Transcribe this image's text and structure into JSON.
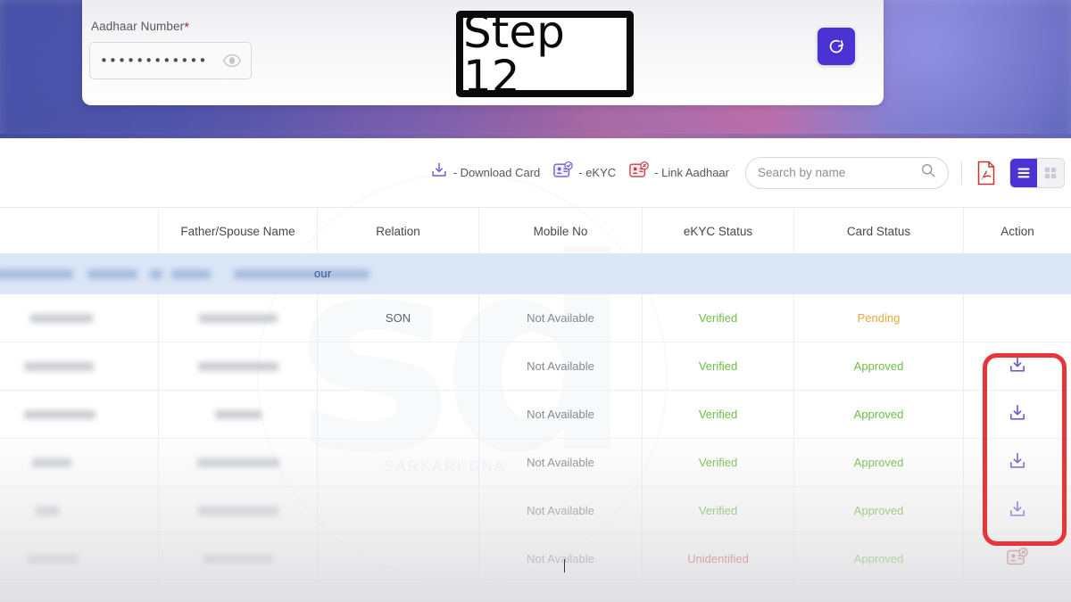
{
  "banner": {
    "form": {
      "label": "Aadhaar Number",
      "required_mark": "*",
      "masked_value": "••••••••••••",
      "eye_icon": "eye-icon",
      "refresh_icon": "refresh-icon"
    }
  },
  "step_badge": {
    "text": "Step 12"
  },
  "toolbar": {
    "legend": [
      {
        "icon": "download-icon",
        "label": "- Download Card",
        "color": "#6b5fd0"
      },
      {
        "icon": "ekyc-card-icon",
        "label": "- eKYC",
        "color": "#6b5fd0"
      },
      {
        "icon": "link-aadhaar-card-icon",
        "label": "- Link Aadhaar",
        "color": "#cf3a45"
      }
    ],
    "search": {
      "placeholder": "Search by name",
      "value": "",
      "icon": "search-icon"
    },
    "pdf_icon": "pdf-export-icon",
    "view_toggle": {
      "list_icon": "list-view-icon",
      "grid_icon": "grid-view-icon",
      "active": "list",
      "active_color": "#4b32d2"
    }
  },
  "table": {
    "columns": [
      {
        "key": "name",
        "label": ""
      },
      {
        "key": "father_spouse",
        "label": "Father/Spouse Name"
      },
      {
        "key": "relation",
        "label": "Relation"
      },
      {
        "key": "mobile",
        "label": "Mobile No"
      },
      {
        "key": "ekyc_status",
        "label": "eKYC Status"
      },
      {
        "key": "card_status",
        "label": "Card Status"
      },
      {
        "key": "action",
        "label": "Action"
      }
    ],
    "highlight_row": {
      "redacted": true,
      "visible_tail": "our"
    },
    "rows": [
      {
        "name": "",
        "father_spouse": "",
        "relation": "SON",
        "mobile": "Not Available",
        "ekyc_status": "Verified",
        "card_status": "Pending",
        "action_icon": ""
      },
      {
        "name": "",
        "father_spouse": "",
        "relation": "",
        "mobile": "Not Available",
        "ekyc_status": "Verified",
        "card_status": "Approved",
        "action_icon": "download-icon"
      },
      {
        "name": "",
        "father_spouse": "",
        "relation": "",
        "mobile": "Not Available",
        "ekyc_status": "Verified",
        "card_status": "Approved",
        "action_icon": "download-icon"
      },
      {
        "name": "",
        "father_spouse": "",
        "relation": "",
        "mobile": "Not Available",
        "ekyc_status": "Verified",
        "card_status": "Approved",
        "action_icon": "download-icon"
      },
      {
        "name": "",
        "father_spouse": "",
        "relation": "",
        "mobile": "Not Available",
        "ekyc_status": "Verified",
        "card_status": "Approved",
        "action_icon": "download-icon"
      },
      {
        "name": "",
        "father_spouse": "",
        "relation": "",
        "mobile": "Not Available",
        "ekyc_status": "Unidentified",
        "card_status": "Approved",
        "action_icon": "link-aadhaar-card-icon"
      }
    ]
  },
  "annotation": {
    "red_highlight_box": {
      "color": "#e8353a",
      "targets": "download-icons-rows-2-to-5"
    }
  },
  "watermark": {
    "text": "sd",
    "subtext": "SARKARI DNA"
  },
  "colors": {
    "accent": "#4b32d2",
    "verified": "#6dbe45",
    "approved": "#6dbe45",
    "pending": "#e8a83a",
    "unidentified": "#cf3a45",
    "highlight_row": "#dbe6f7",
    "annotation_red": "#e8353a"
  }
}
